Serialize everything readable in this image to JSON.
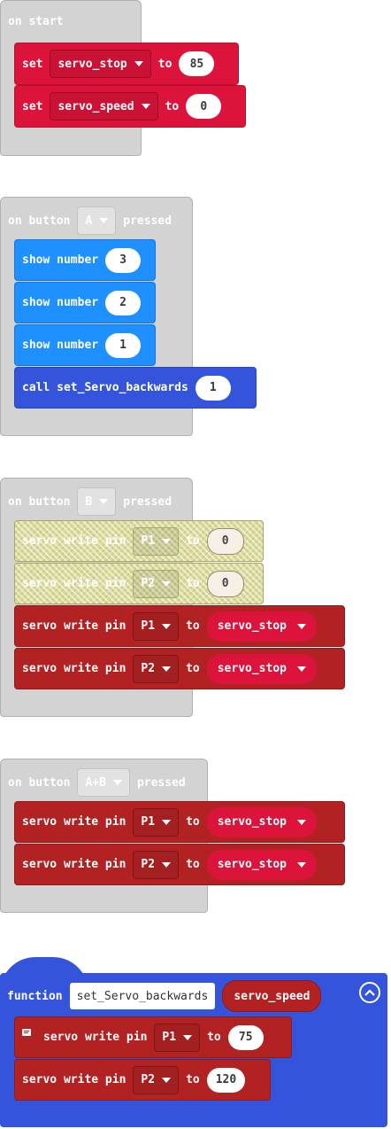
{
  "on_start": {
    "label": "on start",
    "set1": {
      "kw": "set",
      "var": "servo_stop",
      "to": "to",
      "value": "85"
    },
    "set2": {
      "kw": "set",
      "var": "servo_speed",
      "to": "to",
      "value": "0"
    }
  },
  "button_a": {
    "label_on": "on button",
    "button": "A",
    "label_pressed": "pressed",
    "show1": {
      "label": "show number",
      "value": "3"
    },
    "show2": {
      "label": "show number",
      "value": "2"
    },
    "show3": {
      "label": "show number",
      "value": "1"
    },
    "call": {
      "label": "call set_Servo_backwards",
      "value": "1"
    }
  },
  "button_b": {
    "label_on": "on button",
    "button": "B",
    "label_pressed": "pressed",
    "rows": [
      {
        "label": "servo write pin",
        "pin": "P1",
        "to": "to",
        "value": "0"
      },
      {
        "label": "servo write pin",
        "pin": "P2",
        "to": "to",
        "value": "0"
      },
      {
        "label": "servo write pin",
        "pin": "P1",
        "to": "to",
        "value": "servo_stop"
      },
      {
        "label": "servo write pin",
        "pin": "P2",
        "to": "to",
        "value": "servo_stop"
      }
    ]
  },
  "button_ab": {
    "label_on": "on button",
    "button": "A+B",
    "label_pressed": "pressed",
    "rows": [
      {
        "label": "servo write pin",
        "pin": "P1",
        "to": "to",
        "value": "servo_stop"
      },
      {
        "label": "servo write pin",
        "pin": "P2",
        "to": "to",
        "value": "servo_stop"
      }
    ]
  },
  "function": {
    "keyword": "function",
    "name": "set_Servo_backwards",
    "param": "servo_speed",
    "rows": [
      {
        "label": "servo write pin",
        "pin": "P1",
        "to": "to",
        "value": "75"
      },
      {
        "label": "servo write pin",
        "pin": "P2",
        "to": "to",
        "value": "120"
      }
    ]
  },
  "icons": [
    "chevron-down-icon",
    "comment-icon",
    "collapse-up-icon"
  ],
  "colors": {
    "variables": "#dc143c",
    "basic": "#1e90ff",
    "functions": "#3455db",
    "servo": "#b22222",
    "events_disabled": "#d3d3d3"
  }
}
